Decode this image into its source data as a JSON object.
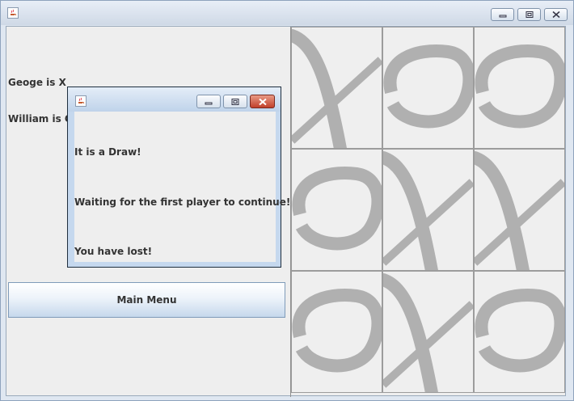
{
  "window": {
    "icon": "java-coffee-icon",
    "controls": [
      "minimize-icon",
      "maximize-icon",
      "close-icon"
    ]
  },
  "players": {
    "player_x": "Geoge is X",
    "player_o": "William is O"
  },
  "main_menu_label": "Main Menu",
  "board": {
    "cells": [
      "X",
      "O",
      "O",
      "O",
      "X",
      "X",
      "O",
      "X",
      "O"
    ]
  },
  "dialog": {
    "icon": "java-coffee-icon",
    "messages": {
      "result": "It is a Draw!",
      "waiting": "Waiting for the first player to continue!",
      "outcome": "You have lost!"
    }
  }
}
